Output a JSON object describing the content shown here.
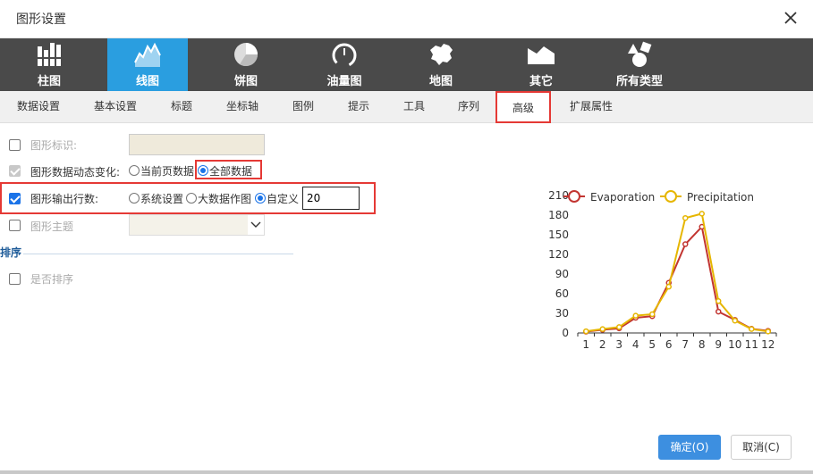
{
  "dialog": {
    "title": "图形设置"
  },
  "chart_types": [
    {
      "label": "柱图",
      "icon": "bar-chart-icon",
      "active": false
    },
    {
      "label": "线图",
      "icon": "line-chart-icon",
      "active": true
    },
    {
      "label": "饼图",
      "icon": "pie-chart-icon",
      "active": false
    },
    {
      "label": "油量图",
      "icon": "gauge-icon",
      "active": false
    },
    {
      "label": "地图",
      "icon": "china-map-icon",
      "active": false
    },
    {
      "label": "其它",
      "icon": "mountain-chart-icon",
      "active": false
    },
    {
      "label": "所有类型",
      "icon": "shapes-icon",
      "active": false
    }
  ],
  "tabs": [
    {
      "label": "数据设置",
      "active": false
    },
    {
      "label": "基本设置",
      "active": false
    },
    {
      "label": "标题",
      "active": false
    },
    {
      "label": "坐标轴",
      "active": false
    },
    {
      "label": "图例",
      "active": false
    },
    {
      "label": "提示",
      "active": false
    },
    {
      "label": "工具",
      "active": false
    },
    {
      "label": "序列",
      "active": false
    },
    {
      "label": "高级",
      "active": true
    },
    {
      "label": "扩展属性",
      "active": false
    }
  ],
  "form": {
    "shape_id": {
      "label": "图形标识:",
      "value": "",
      "checked": false
    },
    "dynamic": {
      "label": "图形数据动态变化:",
      "checked": true,
      "opt1": "当前页数据",
      "opt2": "全部数据"
    },
    "output_rows": {
      "label": "图形输出行数:",
      "checked": true,
      "opt1": "系统设置",
      "opt2": "大数据作图",
      "opt3": "自定义",
      "value": "20"
    },
    "theme": {
      "label": "图形主题",
      "checked": false,
      "value": ""
    },
    "sort_section": "排序",
    "sort": {
      "label": "是否排序",
      "checked": false
    }
  },
  "buttons": {
    "ok": "确定(O)",
    "cancel": "取消(C)"
  },
  "colors": {
    "evaporation": "#c23531",
    "precipitation": "#e6b600",
    "accent": "#2a9ee0",
    "highlight": "#e53935"
  },
  "chart_data": {
    "type": "line",
    "x": [
      1,
      2,
      3,
      4,
      5,
      6,
      7,
      8,
      9,
      10,
      11,
      12
    ],
    "series": [
      {
        "name": "Evaporation",
        "values": [
          2.0,
          4.9,
          7.0,
          23.2,
          25.6,
          76.7,
          135.6,
          162.2,
          32.6,
          20.0,
          6.4,
          3.3
        ]
      },
      {
        "name": "Precipitation",
        "values": [
          2.6,
          5.9,
          9.0,
          26.4,
          28.7,
          70.7,
          175.6,
          182.2,
          48.7,
          18.8,
          6.0,
          2.3
        ]
      }
    ],
    "yticks": [
      "0",
      "30",
      "60",
      "90",
      "120",
      "150",
      "180",
      "210"
    ],
    "ylim": [
      0,
      210
    ],
    "legend": "top",
    "grid": false
  }
}
